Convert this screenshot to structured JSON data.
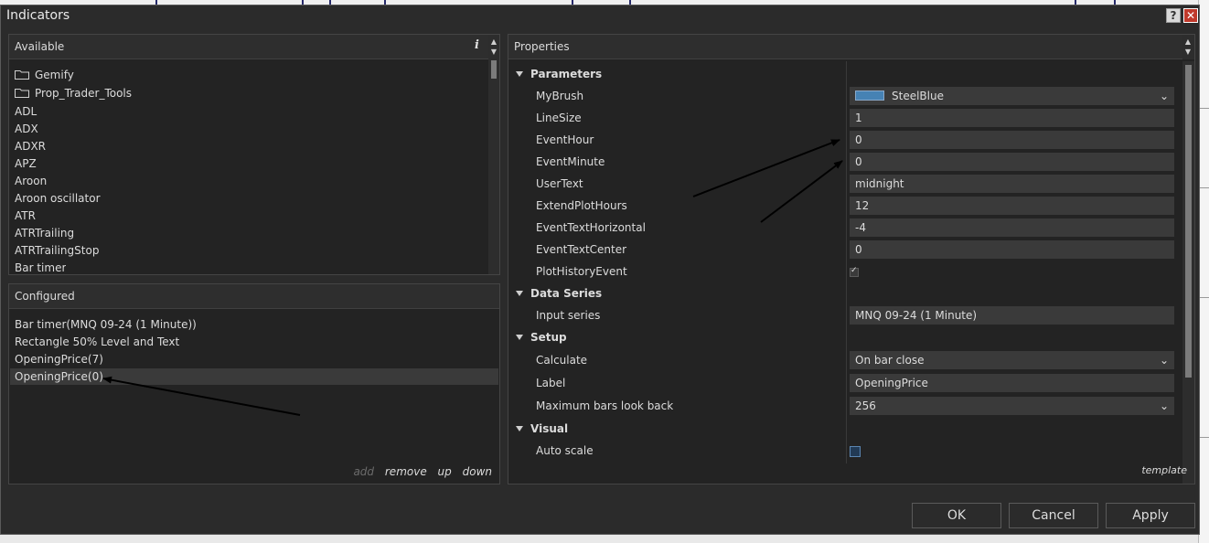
{
  "window": {
    "title": "Indicators"
  },
  "available": {
    "header": "Available",
    "items": [
      {
        "label": "Gemify",
        "folder": true
      },
      {
        "label": "Prop_Trader_Tools",
        "folder": true
      },
      {
        "label": "ADL"
      },
      {
        "label": "ADX"
      },
      {
        "label": "ADXR"
      },
      {
        "label": "APZ"
      },
      {
        "label": "Aroon"
      },
      {
        "label": "Aroon oscillator"
      },
      {
        "label": "ATR"
      },
      {
        "label": "ATRTrailing"
      },
      {
        "label": "ATRTrailingStop"
      },
      {
        "label": "Bar timer"
      }
    ]
  },
  "configured": {
    "header": "Configured",
    "items": [
      {
        "label": "Bar timer(MNQ 09-24 (1 Minute))"
      },
      {
        "label": "Rectangle 50% Level and Text"
      },
      {
        "label": "OpeningPrice(7)"
      },
      {
        "label": "OpeningPrice(0)",
        "selected": true
      }
    ],
    "actions": {
      "add": "add",
      "remove": "remove",
      "up": "up",
      "down": "down"
    }
  },
  "properties": {
    "header": "Properties",
    "categories": [
      {
        "name": "Parameters"
      },
      {
        "name": "Data Series"
      },
      {
        "name": "Setup"
      },
      {
        "name": "Visual"
      }
    ],
    "rows": [
      {
        "name": "MyBrush",
        "value": "SteelBlue",
        "swatch": "#4682b4",
        "dropdown": true
      },
      {
        "name": "LineSize",
        "value": "1"
      },
      {
        "name": "EventHour",
        "value": "0"
      },
      {
        "name": "EventMinute",
        "value": "0"
      },
      {
        "name": "UserText",
        "value": "midnight"
      },
      {
        "name": "ExtendPlotHours",
        "value": "12"
      },
      {
        "name": "EventTextHorizontal",
        "value": "-4"
      },
      {
        "name": "EventTextCenter",
        "value": "0"
      },
      {
        "name": "PlotHistoryEvent",
        "checked": true
      },
      {
        "name": "Input series",
        "value": "MNQ 09-24 (1 Minute)"
      },
      {
        "name": "Calculate",
        "value": "On bar close",
        "dropdown": true
      },
      {
        "name": "Label",
        "value": "OpeningPrice"
      },
      {
        "name": "Maximum bars look back",
        "value": "256",
        "dropdown": true
      },
      {
        "name": "Auto scale",
        "checked": false
      }
    ],
    "template_link": "template"
  },
  "buttons": {
    "ok": "OK",
    "cancel": "Cancel",
    "apply": "Apply"
  },
  "icons": {
    "info": "ⅰ",
    "help": "?",
    "close": "✕",
    "chev": "⌄",
    "check": "✓"
  },
  "colors": {
    "accent_swatch": "#4682b4",
    "close_red": "#c0392b"
  }
}
